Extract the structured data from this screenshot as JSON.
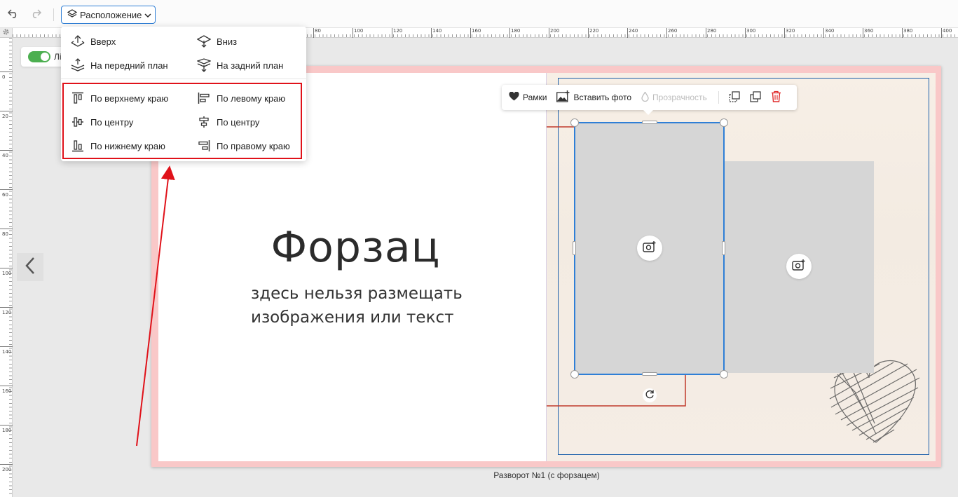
{
  "toolbar": {
    "undo_icon": "undo-icon",
    "redo_icon": "redo-icon",
    "layout_button_label": "Расположение"
  },
  "dropdown": {
    "items": [
      {
        "label": "Вверх",
        "icon": "bring-forward-icon"
      },
      {
        "label": "Вниз",
        "icon": "send-backward-icon"
      },
      {
        "label": "На передний план",
        "icon": "bring-to-front-icon"
      },
      {
        "label": "На задний план",
        "icon": "send-to-back-icon"
      },
      {
        "label": "По верхнему краю",
        "icon": "align-top-icon"
      },
      {
        "label": "По левому краю",
        "icon": "align-left-icon"
      },
      {
        "label": "По центру",
        "icon": "align-middle-icon"
      },
      {
        "label": "По центру",
        "icon": "align-center-icon"
      },
      {
        "label": "По нижнему краю",
        "icon": "align-bottom-icon"
      },
      {
        "label": "По правому краю",
        "icon": "align-right-icon"
      }
    ]
  },
  "ruler": {
    "top_labels": [
      "80",
      "100",
      "120",
      "140",
      "160",
      "180",
      "200",
      "220",
      "240",
      "260",
      "280",
      "300",
      "320",
      "340",
      "360",
      "380",
      "400"
    ],
    "left_labels": [
      "0",
      "20",
      "40",
      "60",
      "80",
      "100",
      "120",
      "140",
      "160",
      "180",
      "200"
    ]
  },
  "toggle": {
    "label": "Лі",
    "state": "on"
  },
  "spread": {
    "title": "Форзац",
    "subtitle_line1": "здесь нельзя размещать",
    "subtitle_line2": "изображения или текст",
    "caption": "Разворот №1 (с форзацем)"
  },
  "float_toolbar": {
    "frames_label": "Рамки",
    "insert_photo_label": "Вставить фото",
    "transparency_label": "Прозрачность"
  },
  "colors": {
    "accent": "#2f7fd6",
    "highlight": "#e0121a",
    "spread_border": "#f9c8c8",
    "delete": "#e02b2b"
  }
}
